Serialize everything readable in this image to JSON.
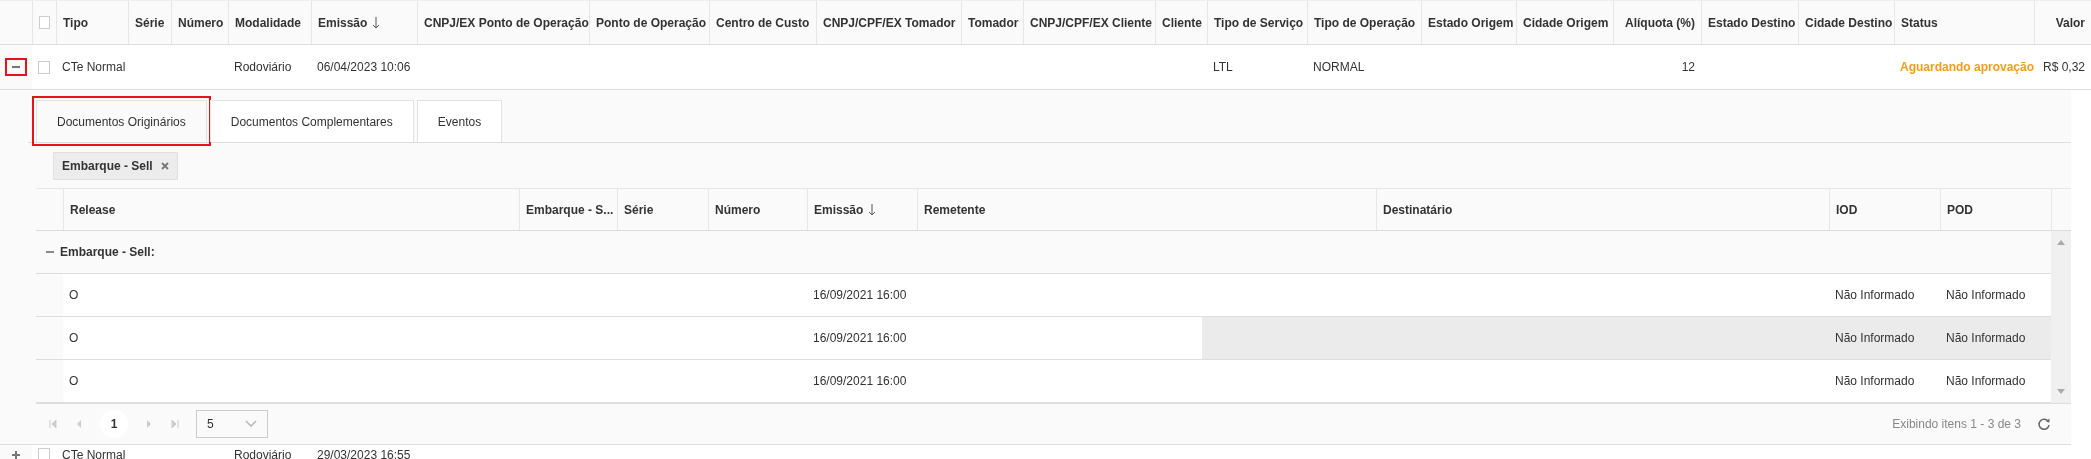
{
  "table": {
    "select_all_checked": false,
    "columns": [
      {
        "label": "Tipo",
        "sorted": false
      },
      {
        "label": "Série",
        "sorted": false
      },
      {
        "label": "Número",
        "sorted": false
      },
      {
        "label": "Modalidade",
        "sorted": false
      },
      {
        "label": "Emissão",
        "sorted": true
      },
      {
        "label": "CNPJ/EX Ponto de Operação",
        "sorted": false
      },
      {
        "label": "Ponto de Operação",
        "sorted": false
      },
      {
        "label": "Centro de Custo",
        "sorted": false
      },
      {
        "label": "CNPJ/CPF/EX Tomador",
        "sorted": false
      },
      {
        "label": "Tomador",
        "sorted": false
      },
      {
        "label": "CNPJ/CPF/EX Cliente",
        "sorted": false
      },
      {
        "label": "Cliente",
        "sorted": false
      },
      {
        "label": "Tipo de Serviço",
        "sorted": false
      },
      {
        "label": "Tipo de Operação",
        "sorted": false
      },
      {
        "label": "Estado Origem",
        "sorted": false
      },
      {
        "label": "Cidade Origem",
        "sorted": false
      },
      {
        "label": "Alíquota (%)",
        "sorted": false
      },
      {
        "label": "Estado Destino",
        "sorted": false
      },
      {
        "label": "Cidade Destino",
        "sorted": false
      },
      {
        "label": "Status",
        "sorted": false
      },
      {
        "label": "Valor",
        "sorted": false
      }
    ],
    "rows": [
      {
        "expanded": true,
        "marked": true,
        "checked": false,
        "cells": [
          "CTe Normal",
          null,
          null,
          "Rodoviário",
          "06/04/2023 10:06",
          null,
          null,
          null,
          null,
          null,
          null,
          null,
          "LTL",
          "NORMAL",
          null,
          null,
          "12",
          null,
          null,
          "Aguardando aprovação",
          "R$ 0,32"
        ],
        "detail": {
          "tabs": [
            {
              "label": "Documentos Originários",
              "selected": true,
              "marked": true
            },
            {
              "label": "Documentos Complementares",
              "selected": false,
              "marked": false
            },
            {
              "label": "Eventos",
              "selected": false,
              "marked": false
            }
          ],
          "group_chips": [
            "Embarque - Sell"
          ],
          "grid": {
            "columns": [
              {
                "label": "Release",
                "sorted": false
              },
              {
                "label": "Embarque - S...",
                "sorted": false
              },
              {
                "label": "Série",
                "sorted": false
              },
              {
                "label": "Número",
                "sorted": false
              },
              {
                "label": "Emissão",
                "sorted": true
              },
              {
                "label": "Remetente",
                "sorted": false
              },
              {
                "label": "Destinatário",
                "sorted": false
              },
              {
                "label": "IOD",
                "sorted": false
              },
              {
                "label": "POD",
                "sorted": false
              }
            ],
            "groups": [
              {
                "label": "Embarque - Sell:",
                "expanded": true,
                "rows": [
                  {
                    "hovered": false,
                    "cells": [
                      "O",
                      null,
                      null,
                      null,
                      "16/09/2021 16:00",
                      null,
                      null,
                      "Não Informado",
                      "Não Informado"
                    ]
                  },
                  {
                    "hovered": true,
                    "cells": [
                      "O",
                      null,
                      null,
                      null,
                      "16/09/2021 16:00",
                      null,
                      null,
                      "Não Informado",
                      "Não Informado"
                    ]
                  },
                  {
                    "hovered": false,
                    "cells": [
                      "O",
                      null,
                      null,
                      null,
                      "16/09/2021 16:00",
                      null,
                      null,
                      "Não Informado",
                      "Não Informado"
                    ]
                  }
                ]
              }
            ],
            "pager": {
              "pages": [
                {
                  "label": "1",
                  "selected": true
                }
              ],
              "page_size": "5",
              "info": "Exibindo itens 1 - 3 de 3"
            }
          }
        }
      },
      {
        "expanded": false,
        "marked": false,
        "checked": false,
        "cells": [
          "CTe Normal",
          null,
          null,
          "Rodoviário",
          "29/03/2023 16:55"
        ]
      }
    ]
  }
}
